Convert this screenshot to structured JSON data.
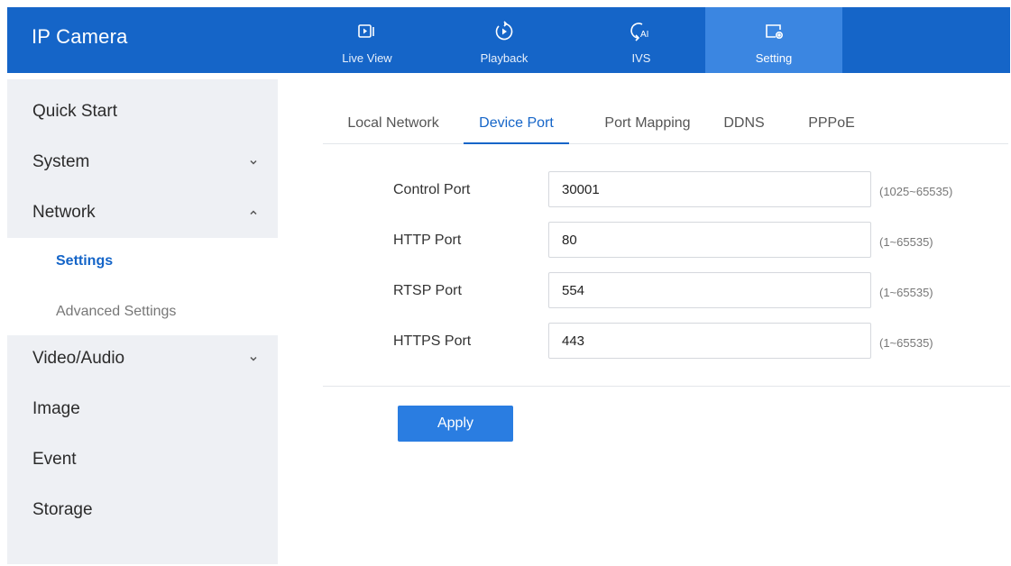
{
  "header": {
    "app_title": "IP Camera",
    "nav": [
      {
        "label": "Live View",
        "icon": "video-icon"
      },
      {
        "label": "Playback",
        "icon": "playback-icon"
      },
      {
        "label": "IVS",
        "icon": "ai-icon"
      },
      {
        "label": "Setting",
        "icon": "settings-icon",
        "active": true
      }
    ]
  },
  "sidebar": {
    "items": [
      {
        "label": "Quick Start"
      },
      {
        "label": "System",
        "expander": "chevron-down-icon"
      },
      {
        "label": "Network",
        "expander": "chevron-up-icon"
      },
      {
        "label": "Video/Audio",
        "expander": "chevron-down-icon"
      },
      {
        "label": "Image"
      },
      {
        "label": "Event"
      },
      {
        "label": "Storage"
      }
    ],
    "network_sub": [
      {
        "label": "Settings",
        "active": true
      },
      {
        "label": "Advanced Settings"
      }
    ]
  },
  "tabs": [
    {
      "label": "Local Network"
    },
    {
      "label": "Device Port",
      "active": true
    },
    {
      "label": "Port Mapping"
    },
    {
      "label": "DDNS"
    },
    {
      "label": "PPPoE"
    }
  ],
  "form": {
    "fields": [
      {
        "label": "Control Port",
        "value": "30001",
        "range": "(1025~65535)"
      },
      {
        "label": "HTTP Port",
        "value": "80",
        "range": "(1~65535)"
      },
      {
        "label": "RTSP Port",
        "value": "554",
        "range": "(1~65535)"
      },
      {
        "label": "HTTPS Port",
        "value": "443",
        "range": "(1~65535)"
      }
    ],
    "apply_label": "Apply"
  },
  "colors": {
    "header_bg": "#1565c8",
    "active_nav": "#3b86e1",
    "accent": "#1565c8",
    "button": "#2a7de1",
    "sidebar_bg": "#eef0f4"
  }
}
